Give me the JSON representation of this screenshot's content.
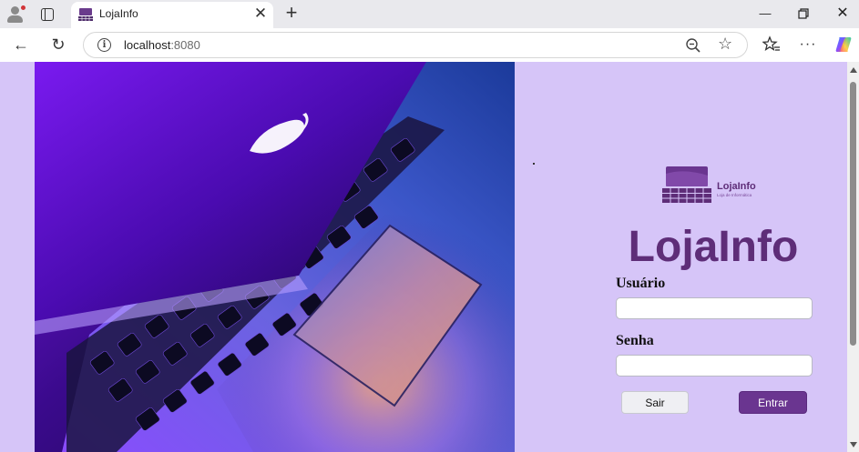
{
  "browser": {
    "tab_title": "LojaInfo",
    "url_host": "localhost",
    "url_port": ":8080"
  },
  "login": {
    "brand_title": "LojaInfo",
    "logo_text": "LojaInfo",
    "logo_subtext": "Loja de Informática",
    "user_label": "Usuário",
    "user_value": "",
    "password_label": "Senha",
    "password_value": "",
    "exit_label": "Sair",
    "enter_label": "Entrar"
  },
  "colors": {
    "page_background": "#d6c5f8",
    "brand": "#5e2d78",
    "primary_button": "#6a3590"
  },
  "icons": {
    "profile": "profile-icon",
    "tabs": "tab-actions-icon",
    "close_tab": "close-icon",
    "new_tab": "plus-icon",
    "back": "back-arrow-icon",
    "reload": "reload-icon",
    "site_info": "info-icon",
    "zoom": "zoom-out-icon",
    "favorite": "star-icon",
    "favorites_list": "favorites-icon",
    "more": "more-icon",
    "copilot": "copilot-icon"
  }
}
